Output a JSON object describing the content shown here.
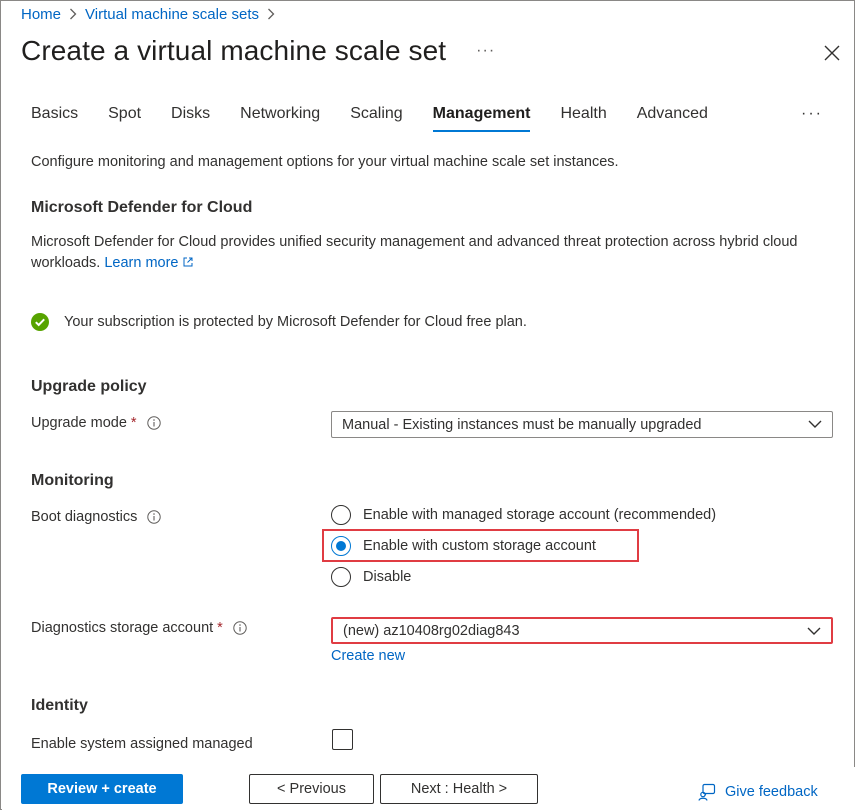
{
  "breadcrumb": {
    "home": "Home",
    "parent": "Virtual machine scale sets"
  },
  "page": {
    "title": "Create a virtual machine scale set",
    "more": "···"
  },
  "tabs": [
    {
      "label": "Basics",
      "active": false
    },
    {
      "label": "Spot",
      "active": false
    },
    {
      "label": "Disks",
      "active": false
    },
    {
      "label": "Networking",
      "active": false
    },
    {
      "label": "Scaling",
      "active": false
    },
    {
      "label": "Management",
      "active": true
    },
    {
      "label": "Health",
      "active": false
    },
    {
      "label": "Advanced",
      "active": false
    }
  ],
  "tabs_more": "···",
  "intro": "Configure monitoring and management options for your virtual machine scale set instances.",
  "defender": {
    "heading": "Microsoft Defender for Cloud",
    "description": "Microsoft Defender for Cloud provides unified security management and advanced threat protection across hybrid cloud workloads.",
    "learn_more": "Learn more",
    "status": "Your subscription is protected by Microsoft Defender for Cloud free plan."
  },
  "upgrade": {
    "heading": "Upgrade policy",
    "mode_label": "Upgrade mode",
    "required_mark": "*",
    "mode_value": "Manual - Existing instances must be manually upgraded"
  },
  "monitoring": {
    "heading": "Monitoring",
    "boot_label": "Boot diagnostics",
    "options": [
      {
        "label": "Enable with managed storage account (recommended)",
        "checked": false
      },
      {
        "label": "Enable with custom storage account",
        "checked": true
      },
      {
        "label": "Disable",
        "checked": false
      }
    ],
    "storage_label": "Diagnostics storage account",
    "required_mark": "*",
    "storage_value": "(new) az10408rg02diag843",
    "create_new": "Create new"
  },
  "identity": {
    "heading": "Identity",
    "system_assigned_label": "Enable system assigned managed"
  },
  "footer": {
    "review_create": "Review + create",
    "previous": "< Previous",
    "next": "Next : Health >",
    "feedback": "Give feedback"
  },
  "colors": {
    "accent": "#0078d4",
    "link": "#0066c4",
    "highlight": "#e03c43",
    "success": "#57a300"
  }
}
